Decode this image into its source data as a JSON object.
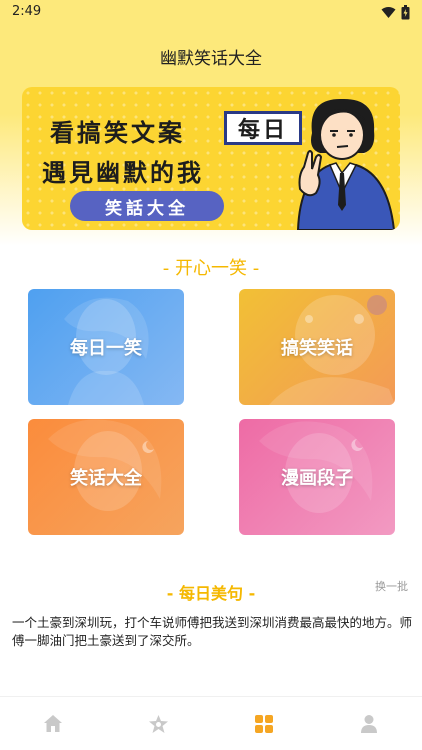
{
  "status_bar": {
    "time": "2:49"
  },
  "header": {
    "title": "幽默笑话大全"
  },
  "banner": {
    "line1": "看搞笑文案",
    "daily_box": "每日",
    "line2": "遇見幽默的我",
    "pill_label": "笑話大全"
  },
  "section_fun": {
    "title": "-  开心一笑  -"
  },
  "cards": [
    {
      "label": "每日一笑"
    },
    {
      "label": "搞笑笑话"
    },
    {
      "label": "笑话大全"
    },
    {
      "label": "漫画段子"
    }
  ],
  "section_quote": {
    "title": "-  每日美句  -",
    "refresh": "换一批",
    "text": "一个土豪到深圳玩，打个车说师傅把我送到深圳消费最高最快的地方。师傅一脚油门把土豪送到了深交所。"
  },
  "nav": {
    "items": [
      "home-icon",
      "star-icon",
      "grid-icon",
      "profile-icon"
    ],
    "active_index": 2,
    "active_color": "#f5a623",
    "inactive_color": "#c9c9c9"
  },
  "colors": {
    "header_yellow": "#fde97b",
    "accent_yellow": "#f5b800"
  }
}
